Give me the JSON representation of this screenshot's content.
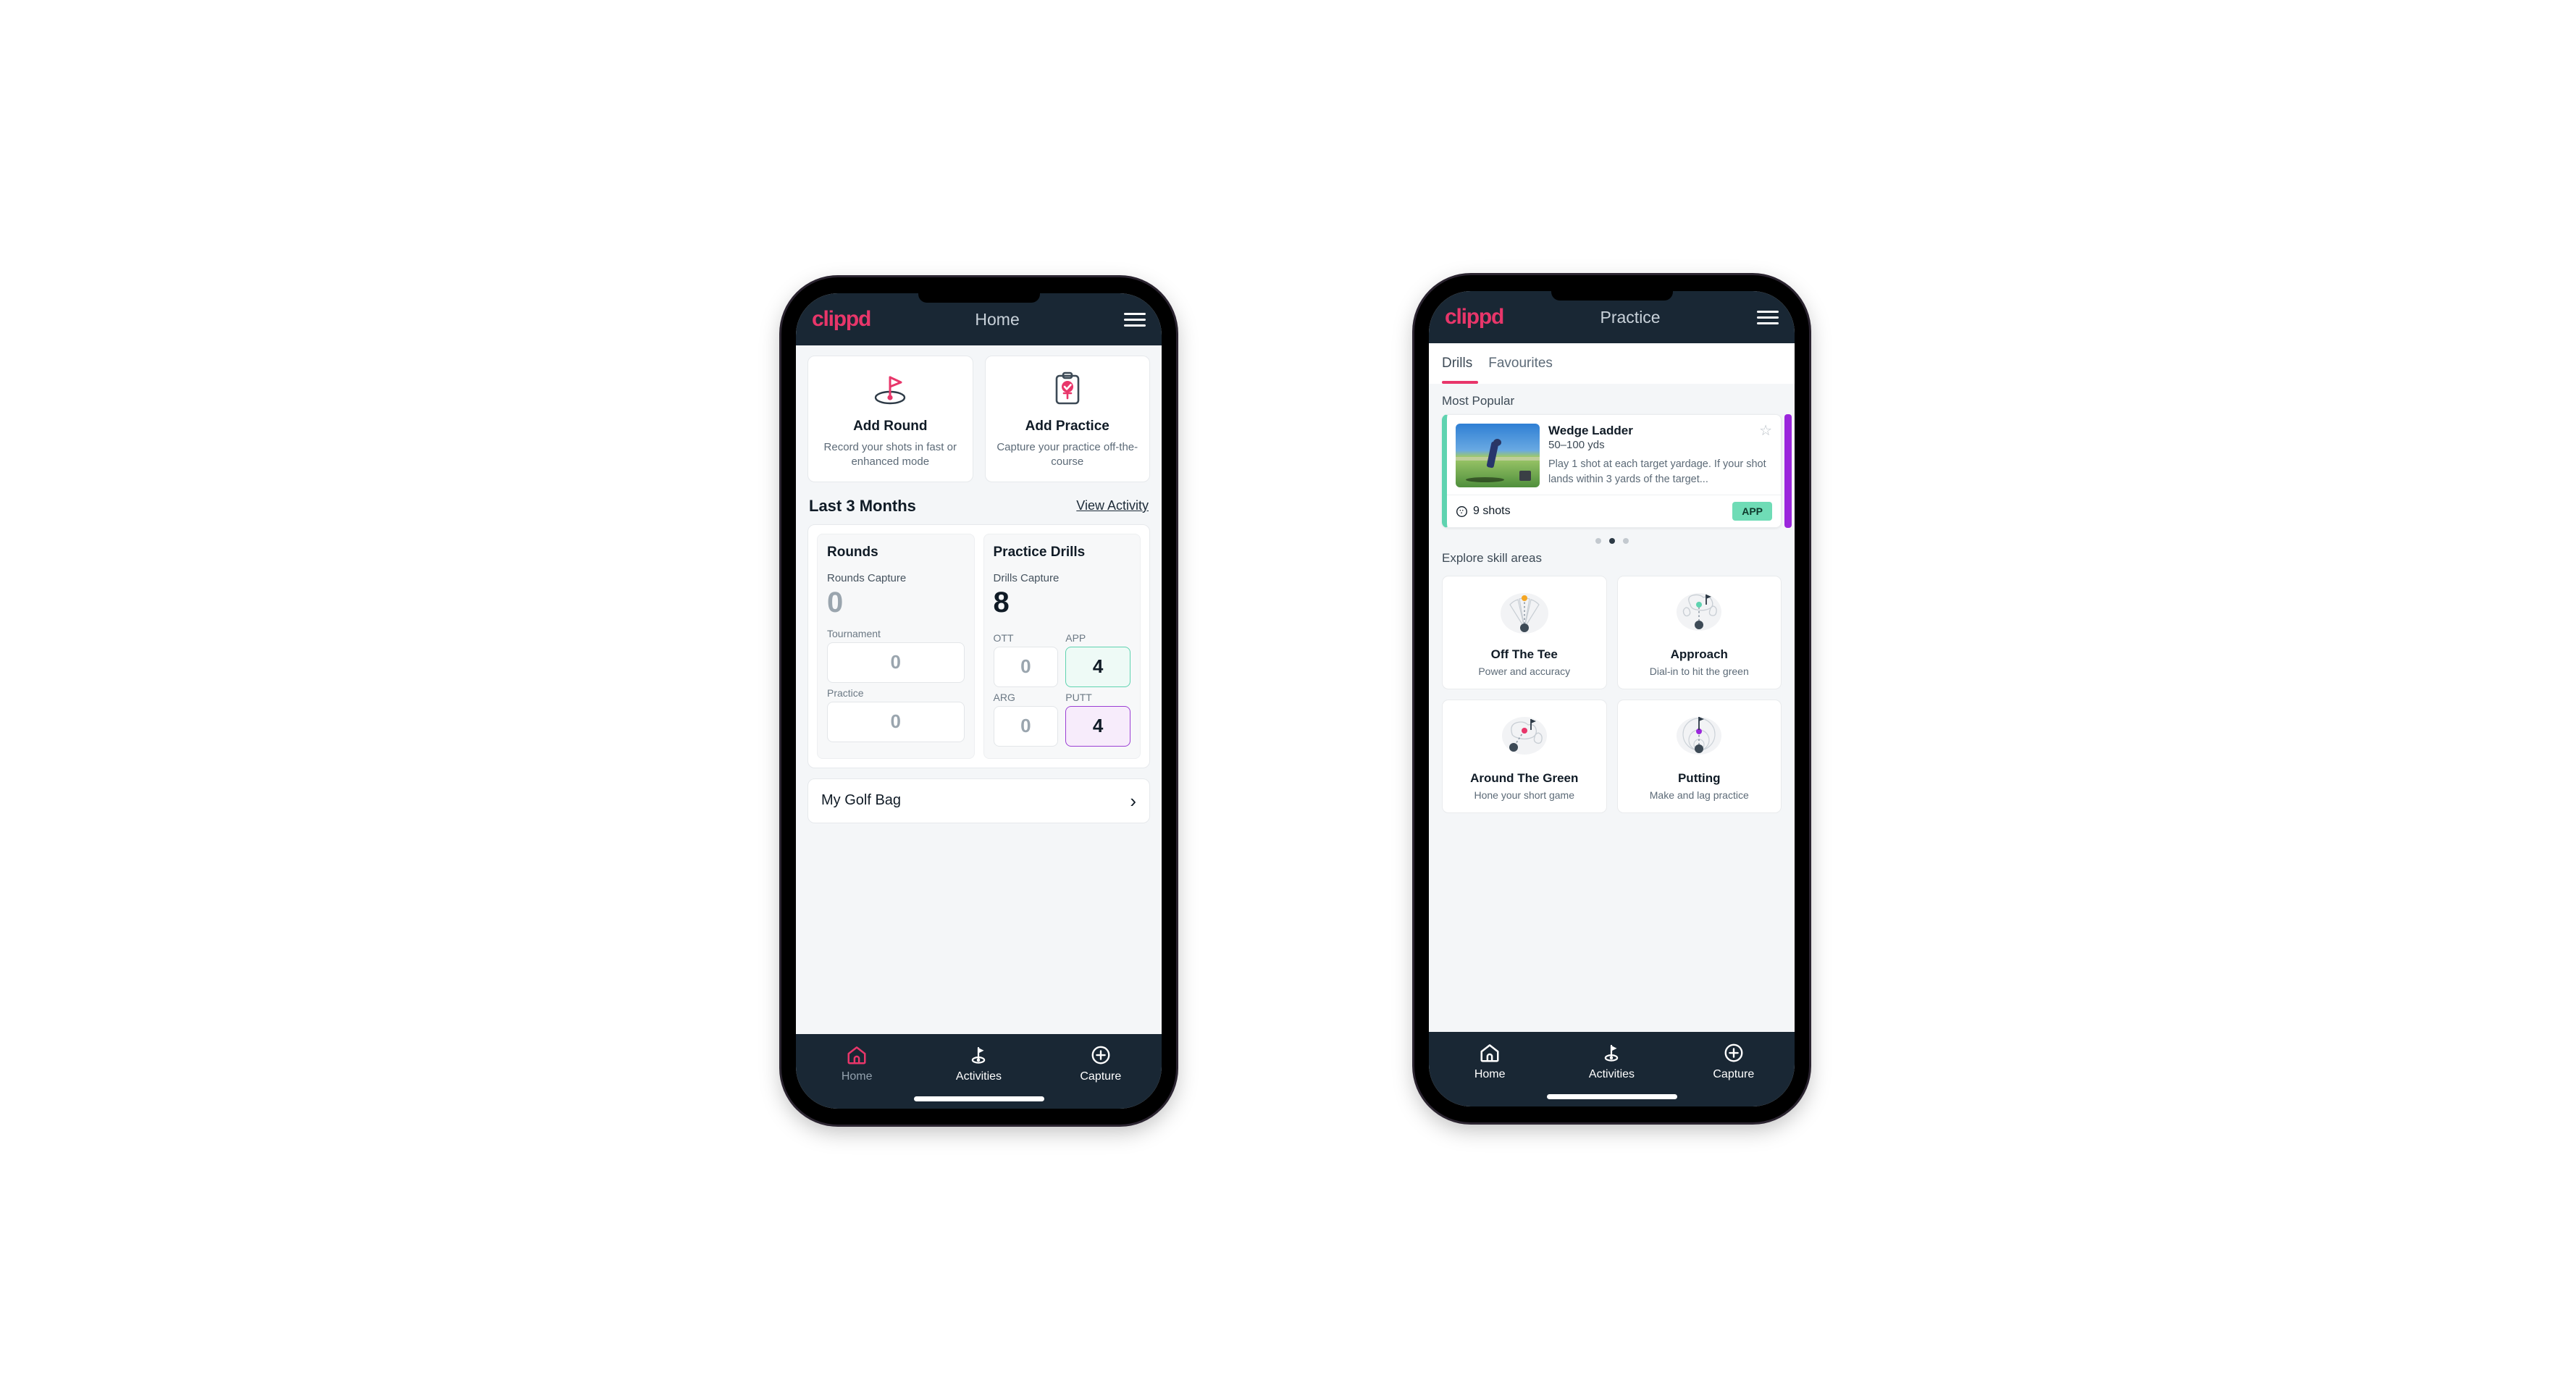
{
  "brand": {
    "logo_text": "clippd",
    "accent": "#e8366a",
    "header_bg": "#192734"
  },
  "phone_home": {
    "appbar": {
      "title": "Home",
      "menu_icon": "hamburger-menu-icon"
    },
    "quick_actions": [
      {
        "icon": "golf-flag-icon",
        "title": "Add Round",
        "subtitle": "Record your shots in fast or enhanced mode"
      },
      {
        "icon": "clipboard-check-icon",
        "title": "Add Practice",
        "subtitle": "Capture your practice off-the-course"
      }
    ],
    "section": {
      "title": "Last 3 Months",
      "link": "View Activity"
    },
    "rounds": {
      "heading": "Rounds",
      "capture_label": "Rounds Capture",
      "capture_value": "0",
      "fields": [
        {
          "label": "Tournament",
          "value": "0",
          "style": "plain"
        },
        {
          "label": "Practice",
          "value": "0",
          "style": "plain"
        }
      ]
    },
    "drills": {
      "heading": "Practice Drills",
      "capture_label": "Drills Capture",
      "capture_value": "8",
      "fields": [
        {
          "label": "OTT",
          "value": "0",
          "style": "plain"
        },
        {
          "label": "APP",
          "value": "4",
          "style": "teal"
        },
        {
          "label": "ARG",
          "value": "0",
          "style": "plain"
        },
        {
          "label": "PUTT",
          "value": "4",
          "style": "purple"
        }
      ]
    },
    "golf_bag": {
      "label": "My Golf Bag",
      "chevron": "chevron-right-icon"
    },
    "bottom_nav": [
      {
        "label": "Home",
        "icon": "home-icon",
        "active": true
      },
      {
        "label": "Activities",
        "icon": "golf-flag-icon",
        "active": false
      },
      {
        "label": "Capture",
        "icon": "plus-circle-icon",
        "active": false
      }
    ]
  },
  "phone_practice": {
    "appbar": {
      "title": "Practice",
      "menu_icon": "hamburger-menu-icon"
    },
    "tabs": [
      {
        "label": "Drills",
        "active": true
      },
      {
        "label": "Favourites",
        "active": false
      }
    ],
    "most_popular_label": "Most Popular",
    "drill_card": {
      "accent_left": "#5fd3b0",
      "accent_peek": "#9b27dc",
      "thumbnail": "golfer-wedge-photo",
      "title": "Wedge Ladder",
      "subtitle": "50–100 yds",
      "description": "Play 1 shot at each target yardage. If your shot lands within 3 yards of the target...",
      "favourite_icon": "star-outline-icon",
      "shots_icon": "golf-ball-icon",
      "shots_text": "9 shots",
      "badge": "APP"
    },
    "carousel_dots": {
      "count": 3,
      "active_index": 1
    },
    "skill_label": "Explore skill areas",
    "skill_areas": [
      {
        "icon": "tee-shot-dispersion-icon",
        "title": "Off The Tee",
        "subtitle": "Power and accuracy",
        "dot_color": "#f5a623"
      },
      {
        "icon": "approach-green-icon",
        "title": "Approach",
        "subtitle": "Dial-in to hit the green",
        "dot_color": "#5fd3b0"
      },
      {
        "icon": "chip-green-icon",
        "title": "Around The Green",
        "subtitle": "Hone your short game",
        "dot_color": "#e8366a"
      },
      {
        "icon": "putting-rings-icon",
        "title": "Putting",
        "subtitle": "Make and lag practice",
        "dot_color": "#9b27dc"
      }
    ],
    "bottom_nav": [
      {
        "label": "Home",
        "icon": "home-icon",
        "active": false
      },
      {
        "label": "Activities",
        "icon": "golf-flag-icon",
        "active": true
      },
      {
        "label": "Capture",
        "icon": "plus-circle-icon",
        "active": false
      }
    ]
  }
}
